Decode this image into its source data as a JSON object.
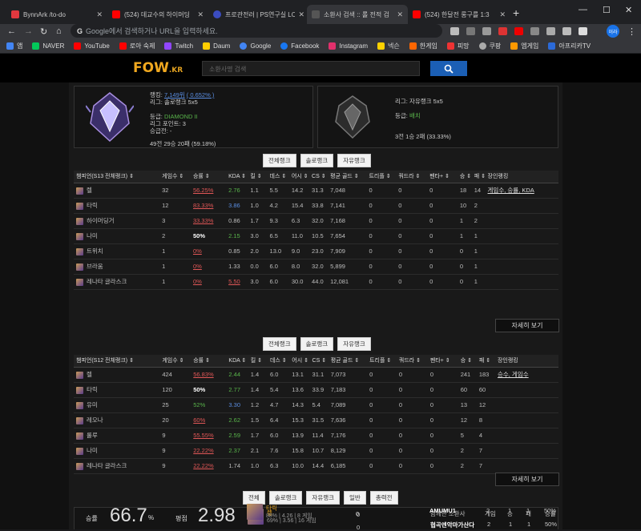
{
  "tabs": [
    {
      "title": "BynnArk /to-do",
      "color": "#e2383f"
    },
    {
      "title": "(524) 데교수의 하이머딩",
      "color": "#ff0000"
    },
    {
      "title": "프로관전러 | PS연구실 LC",
      "color": "#3b4cc0"
    },
    {
      "title": "소환사 검색 :: 롤 전적 검",
      "color": "#555"
    },
    {
      "title": "(524) 한달전 롱구를 1:3",
      "color": "#ff0000"
    }
  ],
  "new_tab": "+",
  "window": {
    "minimize": "—",
    "maximize": "☐",
    "close": "✕"
  },
  "nav": {
    "back": "←",
    "forward": "→",
    "reload": "↻",
    "home": "⌂"
  },
  "url_placeholder": "Google에서 검색하거나 URL을 입력하세요.",
  "profile": "이라",
  "bookmarks": [
    "앱",
    "NAVER",
    "YouTube",
    "로아 숙제",
    "Twitch",
    "Daum",
    "Google",
    "Facebook",
    "Instagram",
    "넥슨",
    "한게임",
    "피망",
    "쿠팡",
    "엠게임",
    "아프리카TV"
  ],
  "site": {
    "logo": "FOW",
    "logo_suffix": ".KR",
    "search_placeholder": "소환사명 검색",
    "solo": {
      "l1": "랭킹:",
      "rank_link": "7,149위",
      "rank_pct": "( 0.652% )",
      "l2": "리그: 솔로랭크 5x5",
      "l3": "등급:",
      "tier": "DIAMOND II",
      "l4": "리그 포인트: 3",
      "l5": "승급전: -",
      "l6": "49전 29승 20패 (59.18%)"
    },
    "flex": {
      "l1": "리그: 자유랭크 5x5",
      "l2": "등급:",
      "tier": "배치",
      "l3": "3전 1승 2패 (33.33%)"
    },
    "filter1": [
      "전체랭크",
      "솔로랭크",
      "자유랭크"
    ],
    "filter2": [
      "전체랭크",
      "솔로랭크",
      "자유랭크"
    ],
    "filter3": [
      "전체",
      "솔로랭크",
      "자유랭크",
      "일반",
      "총력전"
    ],
    "t1_headers": [
      "챔피언(S13 전체랭크) ⇕",
      "게임수 ⇕",
      "승률 ⇕",
      "KDA ⇕",
      "킬 ⇕",
      "데스 ⇕",
      "어시 ⇕",
      "CS ⇕",
      "평균 골드 ⇕",
      "트리플 ⇕",
      "쿼드라 ⇕",
      "펜타+ ⇕",
      "승 ⇕",
      "패 ⇕",
      "장인랭킹"
    ],
    "t1_rows": [
      [
        "렐",
        "32",
        "56.25%",
        "2.76",
        "1.1",
        "5.5",
        "14.2",
        "31.3",
        "7,048",
        "0",
        "0",
        "0",
        "18",
        "14",
        "게임수, 승률, KDA"
      ],
      [
        "타릭",
        "12",
        "83.33%",
        "3.86",
        "1.0",
        "4.2",
        "15.4",
        "33.8",
        "7,141",
        "0",
        "0",
        "0",
        "10",
        "2",
        ""
      ],
      [
        "하이머딩거",
        "3",
        "33.33%",
        "0.86",
        "1.7",
        "9.3",
        "6.3",
        "32.0",
        "7,168",
        "0",
        "0",
        "0",
        "1",
        "2",
        ""
      ],
      [
        "나미",
        "2",
        "50%",
        "2.15",
        "3.0",
        "6.5",
        "11.0",
        "10.5",
        "7,654",
        "0",
        "0",
        "0",
        "1",
        "1",
        ""
      ],
      [
        "트위치",
        "1",
        "0%",
        "0.85",
        "2.0",
        "13.0",
        "9.0",
        "23.0",
        "7,909",
        "0",
        "0",
        "0",
        "0",
        "1",
        ""
      ],
      [
        "브라움",
        "1",
        "0%",
        "1.33",
        "0.0",
        "6.0",
        "8.0",
        "32.0",
        "5,899",
        "0",
        "0",
        "0",
        "0",
        "1",
        ""
      ],
      [
        "레나타 글라스크",
        "1",
        "0%",
        "5.50",
        "3.0",
        "6.0",
        "30.0",
        "44.0",
        "12,081",
        "0",
        "0",
        "0",
        "0",
        "1",
        ""
      ]
    ],
    "more1": "자세히 보기",
    "t2_headers": [
      "챔피언(S12 전체랭크) ⇕",
      "게임수 ⇕",
      "승률 ⇕",
      "KDA ⇕",
      "킬 ⇕",
      "데스 ⇕",
      "어시 ⇕",
      "CS ⇕",
      "평균 골드 ⇕",
      "트리플 ⇕",
      "쿼드라 ⇕",
      "펜타+ ⇕",
      "승 ⇕",
      "패 ⇕",
      "장인랭킹"
    ],
    "t2_rows": [
      [
        "렐",
        "424",
        "56.83%",
        "2.44",
        "1.4",
        "6.0",
        "13.1",
        "31.1",
        "7,073",
        "0",
        "0",
        "0",
        "241",
        "183",
        "승수, 게임수"
      ],
      [
        "타릭",
        "120",
        "50%",
        "2.77",
        "1.4",
        "5.4",
        "13.6",
        "33.9",
        "7,183",
        "0",
        "0",
        "0",
        "60",
        "60",
        ""
      ],
      [
        "유미",
        "25",
        "52%",
        "3.30",
        "1.2",
        "4.7",
        "14.3",
        "5.4",
        "7,089",
        "0",
        "0",
        "0",
        "13",
        "12",
        ""
      ],
      [
        "레오나",
        "20",
        "60%",
        "2.62",
        "1.5",
        "6.4",
        "15.3",
        "31.5",
        "7,636",
        "0",
        "0",
        "0",
        "12",
        "8",
        ""
      ],
      [
        "룰루",
        "9",
        "55.55%",
        "2.59",
        "1.7",
        "6.0",
        "13.9",
        "11.4",
        "7,176",
        "0",
        "0",
        "0",
        "5",
        "4",
        ""
      ],
      [
        "나미",
        "9",
        "22.22%",
        "2.37",
        "2.1",
        "7.6",
        "15.8",
        "10.7",
        "8,129",
        "0",
        "0",
        "0",
        "2",
        "7",
        ""
      ],
      [
        "레나타 글라스크",
        "9",
        "22.22%",
        "1.74",
        "1.0",
        "6.3",
        "10.0",
        "14.4",
        "6,185",
        "0",
        "0",
        "0",
        "2",
        "7",
        ""
      ]
    ],
    "more2": "자세히 보기",
    "summary": {
      "wr_label": "승률",
      "wr_value": "66.7",
      "wr_unit": "%",
      "avg_label": "평점",
      "avg_value": "2.98",
      "champs": [
        {
          "name": "렐",
          "stat": "69% | 3.56 | 16 게임"
        },
        {
          "name": "타릭",
          "stat": "88% | 4.26 | 8 게임"
        }
      ],
      "zeros": [
        "0",
        "0",
        "0"
      ],
      "together_headers": [
        "함께한 소환사",
        "게임",
        "승",
        "패",
        "승률"
      ],
      "together": [
        [
          "협곡엔악마가산다",
          "2",
          "1",
          "1",
          "50%"
        ],
        [
          "AMUMU1",
          "2",
          "1",
          "1",
          "50%"
        ]
      ]
    }
  }
}
